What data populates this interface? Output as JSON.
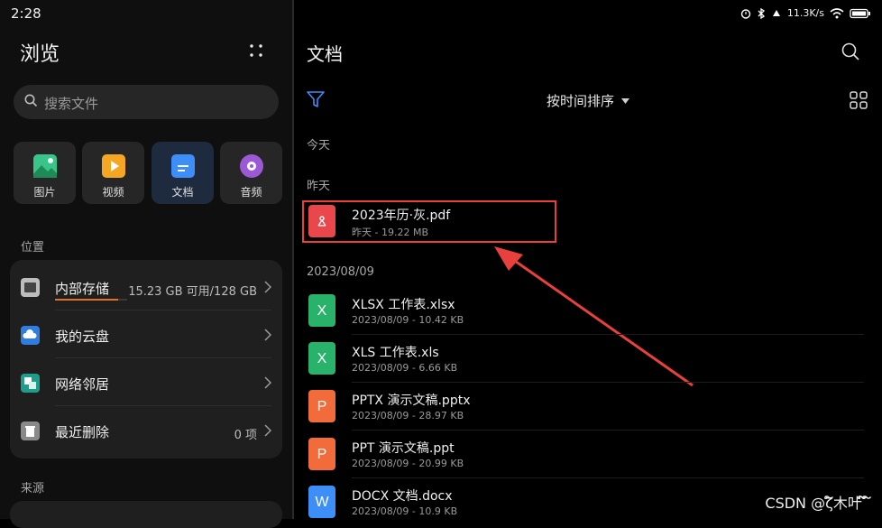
{
  "status": {
    "time": "2:28",
    "net_speed": "11.3K/s"
  },
  "left": {
    "title": "浏览",
    "search_placeholder": "搜索文件",
    "categories": [
      {
        "label": "图片",
        "icon": "image-icon",
        "color": "#2bb673"
      },
      {
        "label": "视频",
        "icon": "video-icon",
        "color": "#f5a623"
      },
      {
        "label": "文档",
        "icon": "document-icon",
        "color": "#3d8ef7"
      },
      {
        "label": "音频",
        "icon": "music-icon",
        "color": "#9b59d6"
      }
    ],
    "location_label": "位置",
    "locations": [
      {
        "name": "内部存储",
        "value": "15.23 GB 可用/128 GB",
        "icon": "storage-icon",
        "usage": 0.88
      },
      {
        "name": "我的云盘",
        "value": "",
        "icon": "cloud-icon"
      },
      {
        "name": "网络邻居",
        "value": "",
        "icon": "network-icon"
      },
      {
        "name": "最近删除",
        "value": "0 项",
        "icon": "trash-icon"
      }
    ],
    "source_label": "来源"
  },
  "right": {
    "title": "文档",
    "sort_label": "按时间排序",
    "groups": {
      "today": "今天",
      "yesterday": "昨天",
      "date": "2023/08/09"
    },
    "files": [
      {
        "name": "2023年历·灰.pdf",
        "meta": "昨天 - 19.22 MB",
        "type": "pdf",
        "color": "#e9474c",
        "letter": ""
      },
      {
        "name": "XLSX 工作表.xlsx",
        "meta": "2023/08/09 - 10.42 KB",
        "type": "xlsx",
        "color": "#29b26a",
        "letter": "X"
      },
      {
        "name": "XLS 工作表.xls",
        "meta": "2023/08/09 - 6.66 KB",
        "type": "xls",
        "color": "#29b26a",
        "letter": "X"
      },
      {
        "name": "PPTX 演示文稿.pptx",
        "meta": "2023/08/09 - 28.97 KB",
        "type": "pptx",
        "color": "#f26b3a",
        "letter": "P"
      },
      {
        "name": "PPT 演示文稿.ppt",
        "meta": "2023/08/09 - 20.99 KB",
        "type": "ppt",
        "color": "#f26b3a",
        "letter": "P"
      },
      {
        "name": "DOCX 文档.docx",
        "meta": "2023/08/09 - 10.9 KB",
        "type": "docx",
        "color": "#3d8ef7",
        "letter": "W"
      }
    ]
  },
  "watermark": "CSDN @ζ໌木叶 ໌໌ ໌",
  "colors": {
    "highlight": "#e8413d",
    "accent": "#3d8ef7"
  }
}
